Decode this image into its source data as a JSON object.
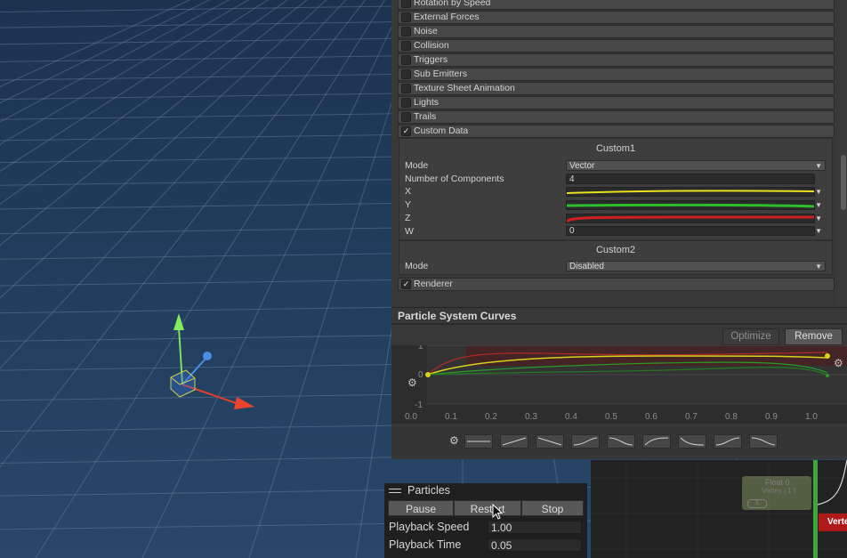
{
  "inspector": {
    "modules": [
      {
        "label": "Rotation by Speed",
        "checked": false
      },
      {
        "label": "External Forces",
        "checked": false
      },
      {
        "label": "Noise",
        "checked": false
      },
      {
        "label": "Collision",
        "checked": false
      },
      {
        "label": "Triggers",
        "checked": false
      },
      {
        "label": "Sub Emitters",
        "checked": false
      },
      {
        "label": "Texture Sheet Animation",
        "checked": false
      },
      {
        "label": "Lights",
        "checked": false
      },
      {
        "label": "Trails",
        "checked": false
      },
      {
        "label": "Custom Data",
        "checked": true
      }
    ],
    "check_mark": "✓",
    "custom1": {
      "title": "Custom1",
      "mode_label": "Mode",
      "mode_value": "Vector",
      "components_label": "Number of Components",
      "components_value": "4",
      "x_label": "X",
      "y_label": "Y",
      "z_label": "Z",
      "w_label": "W",
      "w_value": "0"
    },
    "custom2": {
      "title": "Custom2",
      "mode_label": "Mode",
      "mode_value": "Disabled"
    },
    "renderer": {
      "label": "Renderer",
      "checked": true
    },
    "dropdown_arrow": "▼"
  },
  "curves": {
    "title": "Particle System Curves",
    "optimize_label": "Optimize",
    "remove_label": "Remove",
    "y_ticks": [
      "1",
      "0",
      "-1"
    ],
    "x_ticks": [
      "0.0",
      "0.1",
      "0.2",
      "0.3",
      "0.4",
      "0.5",
      "0.6",
      "0.7",
      "0.8",
      "0.9",
      "1.0"
    ],
    "colors": {
      "x": "#e8e21c",
      "y": "#2cbf2c",
      "z": "#d12020"
    }
  },
  "graph_editor": {
    "node_title": "Float 0",
    "node_subtitle": "Vertex | 1 f",
    "node_port": "1",
    "vertex_label": "Verte"
  },
  "particles_overlay": {
    "title": "Particles",
    "pause_label": "Pause",
    "restart_label": "Restart",
    "stop_label": "Stop",
    "speed_label": "Playback Speed",
    "speed_value": "1.00",
    "time_label": "Playback Time",
    "time_value": "0.05"
  }
}
